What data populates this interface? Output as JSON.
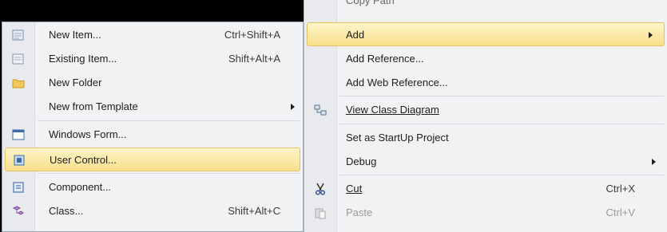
{
  "context_menu": {
    "partial_top_item": "Copy Path",
    "items": [
      {
        "label": "Add",
        "has_submenu": true,
        "highlighted": true
      },
      {
        "label": "Add Reference..."
      },
      {
        "label": "Add Web Reference..."
      },
      {
        "label": "View Class Diagram",
        "icon": "class-diagram-icon"
      },
      {
        "label": "Set as StartUp Project"
      },
      {
        "label": "Debug",
        "has_submenu": true
      },
      {
        "label": "Cut",
        "shortcut": "Ctrl+X",
        "icon": "scissors-icon"
      },
      {
        "label": "Paste",
        "shortcut": "Ctrl+V",
        "icon": "paste-icon",
        "disabled": true
      }
    ]
  },
  "add_submenu": {
    "items": [
      {
        "label": "New Item...",
        "shortcut": "Ctrl+Shift+A",
        "icon": "new-item-icon"
      },
      {
        "label": "Existing Item...",
        "shortcut": "Shift+Alt+A",
        "icon": "existing-item-icon"
      },
      {
        "label": "New Folder",
        "icon": "folder-icon"
      },
      {
        "label": "New from Template",
        "has_submenu": true
      },
      {
        "label": "Windows Form...",
        "icon": "windows-form-icon"
      },
      {
        "label": "User Control...",
        "icon": "user-control-icon",
        "highlighted": true
      },
      {
        "label": "Component...",
        "icon": "component-icon"
      },
      {
        "label": "Class...",
        "shortcut": "Shift+Alt+C",
        "icon": "class-icon"
      }
    ]
  },
  "colors": {
    "menu_bg": "#f1f2f4",
    "highlight_top": "#fdf4c8",
    "highlight_bottom": "#f8df8b",
    "highlight_border": "#e5c365"
  }
}
